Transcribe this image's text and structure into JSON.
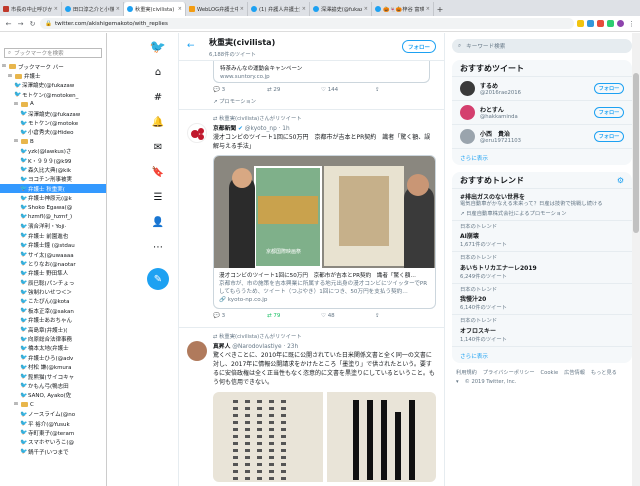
{
  "browser": {
    "tabs": [
      {
        "title": "市長の中止呼びかけ…",
        "fav": "sq"
      },
      {
        "title": "田口淳之介と小嶺麗…",
        "fav": "tw"
      },
      {
        "title": "秋重実(civilista)",
        "fav": "tw",
        "active": true
      },
      {
        "title": "WebLOG弁護士中村…",
        "fav": "gr"
      },
      {
        "title": "(1) 弁護人弁護士東…",
        "fav": "tw"
      },
      {
        "title": "深澤諭史(@fukazaw…",
        "fav": "tw"
      },
      {
        "title": "🎃👻🎃梓谷 富瑛田…",
        "fav": "tw"
      }
    ],
    "url": "twitter.com/akishigemakoto/with_replies"
  },
  "bookmarks": {
    "search_placeholder": "ブックマークを検索",
    "rows": [
      {
        "label": "ブックマーク バー",
        "type": "folder",
        "level": 0
      },
      {
        "label": "弁護士",
        "type": "folder",
        "level": 1
      },
      {
        "label": "深澤諭史(@fukazaw",
        "type": "tw",
        "level": 2
      },
      {
        "label": "モトケン(@motoken_",
        "type": "tw",
        "level": 2
      },
      {
        "label": "A",
        "type": "folder",
        "level": 2
      },
      {
        "label": "深澤諭史(@fukazaw",
        "type": "tw",
        "level": 3
      },
      {
        "label": "モトケン(@motoke",
        "type": "tw",
        "level": 3
      },
      {
        "label": "小倉秀夫(@Hideo",
        "type": "tw",
        "level": 3
      },
      {
        "label": "B",
        "type": "folder",
        "level": 2
      },
      {
        "label": "yzk(@lawkus)さ",
        "type": "tw",
        "level": 3
      },
      {
        "label": "K・９９９(@k99",
        "type": "tw",
        "level": 3
      },
      {
        "label": "森久比大典(@kik",
        "type": "tw",
        "level": 3
      },
      {
        "label": "ヨコチン刑事被実",
        "type": "tw",
        "level": 3
      },
      {
        "label": "弁護士 秋重実(",
        "type": "tw",
        "level": 3,
        "selected": true
      },
      {
        "label": "弁護士神原元(@k",
        "type": "tw",
        "level": 3
      },
      {
        "label": "Shoko Egawa(@",
        "type": "tw",
        "level": 3
      },
      {
        "label": "hzmfl(@_hzmf_)",
        "type": "tw",
        "level": 3
      },
      {
        "label": "濱合洋利・Yoji·",
        "type": "tw",
        "level": 3
      },
      {
        "label": "弁護士 前園進也",
        "type": "tw",
        "level": 3
      },
      {
        "label": "弁護士鐘 (@stdau",
        "type": "tw",
        "level": 3
      },
      {
        "label": "サイ太(@uwaaaa",
        "type": "tw",
        "level": 3
      },
      {
        "label": "とりなお(@naotar",
        "type": "tw",
        "level": 3
      },
      {
        "label": "弁護士  野田隼人",
        "type": "tw",
        "level": 3
      },
      {
        "label": "辰巳聡(パンチょっ",
        "type": "tw",
        "level": 3
      },
      {
        "label": "強制わいせつ＜＞",
        "type": "tw",
        "level": 3
      },
      {
        "label": "こたぴん(@kota",
        "type": "tw",
        "level": 3
      },
      {
        "label": "板本正幸(@sakan",
        "type": "tw",
        "level": 3
      },
      {
        "label": "弁護士あおちゃん",
        "type": "tw",
        "level": 3
      },
      {
        "label": "高島章(弁護士)(",
        "type": "tw",
        "level": 3
      },
      {
        "label": "向原総合法律事務",
        "type": "tw",
        "level": 3
      },
      {
        "label": "橋本太地(弁護士",
        "type": "tw",
        "level": 3
      },
      {
        "label": "弁護士ひろ(@adv",
        "type": "tw",
        "level": 3
      },
      {
        "label": "村松 謙(@kmura",
        "type": "tw",
        "level": 3
      },
      {
        "label": "髭熊猫(サイコキャ",
        "type": "tw",
        "level": 3
      },
      {
        "label": "かもん弓(鴨志田",
        "type": "tw",
        "level": 3
      },
      {
        "label": "SANO, Ayako(佐",
        "type": "tw",
        "level": 3
      },
      {
        "label": "C",
        "type": "folder",
        "level": 2
      },
      {
        "label": "ノースライム(@no",
        "type": "tw",
        "level": 3
      },
      {
        "label": "平  裕介(@Yusuk",
        "type": "tw",
        "level": 3
      },
      {
        "label": "寺町東子(@teram",
        "type": "tw",
        "level": 3
      },
      {
        "label": "スマホヤいろこ(@",
        "type": "tw",
        "level": 3
      },
      {
        "label": "鍋千子(いつまで",
        "type": "tw",
        "level": 3
      }
    ]
  },
  "profile": {
    "name": "秋重実(civilista)",
    "tweet_count": "6,188件のツイート",
    "follow_label": "フォロー"
  },
  "promoted_card": {
    "title": "特茶みんなの運動会キャンペーン",
    "domain": "www.suntory.co.jp",
    "replies": "3",
    "retweets": "29",
    "likes": "144",
    "promo_label": "プロモーション"
  },
  "tweets": [
    {
      "rt_label": "秋重実(civilista)さんがリツイート",
      "name": "京都新聞",
      "handle": "@kyoto_np · 1h",
      "text": "漫才コンビのツイート1回に50万円　京都市が吉本とPR契約　識者「驚く額、誤解与える手法」",
      "card_title": "漫才コンビのツイート1回に50万円　京都市が吉本とPR契約　識者「驚く額…",
      "card_desc": "京都市が、市の施策を吉本興業に所属する地元出身の漫才コンビにツイッターでPRしてもらうため、ツイート（つぶやき）1回につき、50万円を支払う契約…",
      "card_domain": "kyoto-np.co.jp",
      "photo_text": "京都国際映画祭",
      "replies": "3",
      "retweets": "79",
      "likes": "48"
    },
    {
      "rt_label": "秋重実(civilista)さんがリツイート",
      "name": "真昇人",
      "handle": "@NarodovIastiye · 23h",
      "text": "驚くべきことに、2010年に既に公開されていた日米関係文書と全く同一の文書に対し、2017年に情報公開請求をかけたところ「墨塗り」で供されたという。要するに安倍政権は全く正当性もなく恣意的に文書を黒塗りにしているということ。もう何も信用できない。"
    }
  ],
  "right": {
    "search_placeholder": "キーワード検索",
    "who_to_follow_title": "おすすめツイート",
    "accounts": [
      {
        "name": "するめ",
        "handle": "@2016rae2016",
        "follow": "フォロー",
        "color": "#3a3a3a"
      },
      {
        "name": "わとすん",
        "handle": "@hakkaminda",
        "follow": "フォロー",
        "color": "#d43f6e"
      },
      {
        "name": "小西　貴治",
        "handle": "@eru19721103",
        "follow": "フォロー",
        "color": "#9aa4ad"
      }
    ],
    "show_more": "さらに表示",
    "trends_title": "おすすめトレンド",
    "trends": [
      {
        "tag": "#排出ガスのない世界を",
        "desc": "電気自動車がかなえる未来って？日産は技術で挑戦し続ける",
        "count": "日産自動車株式会社によるプロモーション"
      },
      {
        "tag": "AI崩壊",
        "desc": "日本のトレンド",
        "count": "1,671件のツイート"
      },
      {
        "tag": "あいちトリカエナーレ2019",
        "desc": "日本のトレンド",
        "count": "6,249件のツイート"
      },
      {
        "tag": "我慢汁20",
        "desc": "日本のトレンド",
        "count": "6,140件のツイート"
      },
      {
        "tag": "オフロスキー",
        "desc": "日本のトレンド",
        "count": "1,140件のツイート"
      }
    ],
    "trends_more": "さらに表示",
    "footer": [
      "利用規約",
      "プライバシーポリシー",
      "Cookie",
      "広告情報",
      "もっと見る ▾",
      "© 2019 Twitter, Inc."
    ]
  }
}
